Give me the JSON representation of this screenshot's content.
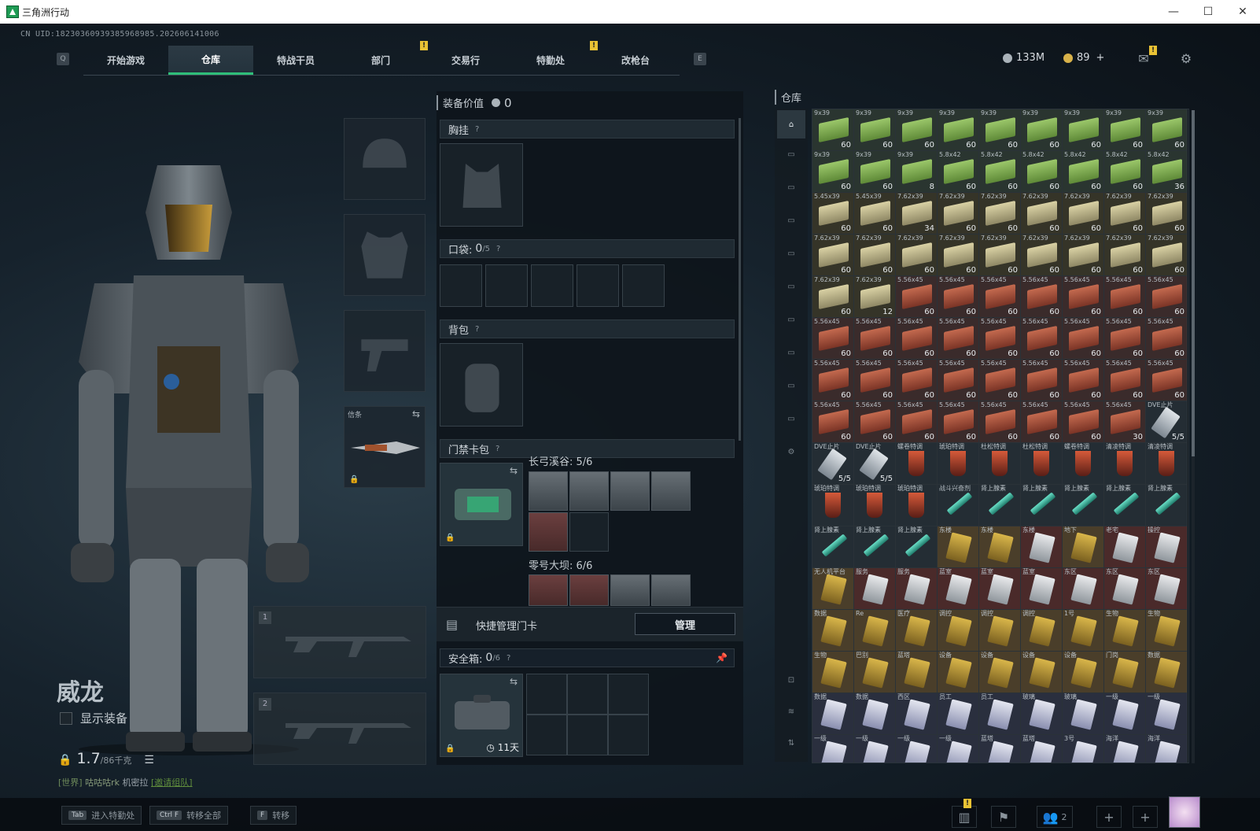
{
  "window": {
    "title": "三角洲行动",
    "minimize": "—",
    "maximize": "☐",
    "close": "✕"
  },
  "uid": "CN UID:18230360939385968985.202606141006",
  "nav": {
    "key_left": "Q",
    "key_right": "E",
    "tabs": [
      {
        "label": "开始游戏"
      },
      {
        "label": "仓库"
      },
      {
        "label": "特战干员"
      },
      {
        "label": "部门",
        "badge": "!"
      },
      {
        "label": "交易行"
      },
      {
        "label": "特勤处",
        "badge": "!"
      },
      {
        "label": "改枪台"
      }
    ]
  },
  "currency": {
    "silver": "133M",
    "gold": "89",
    "plus": "+"
  },
  "mail_badge": "!",
  "operator": {
    "name": "威龙",
    "show_gear": "显示装备",
    "weight": "1.7",
    "weight_unit": "/86千克"
  },
  "chat": {
    "channel": "[世界]",
    "name": "咕咕咕rk",
    "msg": "机密拉",
    "link": "[邀请组队]"
  },
  "gear": {
    "melee_label": "信条",
    "weapon1": "1",
    "weapon2": "2"
  },
  "loadout": {
    "value_label": "装备价值",
    "value": "0",
    "chest": "胸挂",
    "pocket": "口袋:",
    "pocket_count": "0",
    "pocket_cap": "/5",
    "backpack": "背包",
    "keycard_pack": "门禁卡包",
    "keyset1": {
      "name": "长弓溪谷:",
      "count": "5/6"
    },
    "keyset2": {
      "name": "零号大坝:",
      "count": "6/6"
    },
    "quick_manage": "快捷管理门卡",
    "manage_btn": "管理",
    "safe_box": "安全箱:",
    "safe_count": "0",
    "safe_cap": "/6",
    "safe_timer": "11天",
    "help": "?"
  },
  "warehouse": {
    "title": "仓库",
    "items": [
      {
        "l": "9x39",
        "c": "60",
        "t": "green"
      },
      {
        "l": "9x39",
        "c": "60",
        "t": "green"
      },
      {
        "l": "9x39",
        "c": "60",
        "t": "green"
      },
      {
        "l": "9x39",
        "c": "60",
        "t": "green"
      },
      {
        "l": "9x39",
        "c": "60",
        "t": "green"
      },
      {
        "l": "9x39",
        "c": "60",
        "t": "green"
      },
      {
        "l": "9x39",
        "c": "60",
        "t": "green"
      },
      {
        "l": "9x39",
        "c": "60",
        "t": "green"
      },
      {
        "l": "9x39",
        "c": "60",
        "t": "green"
      },
      {
        "l": "9x39",
        "c": "60",
        "t": "green"
      },
      {
        "l": "9x39",
        "c": "60",
        "t": "green"
      },
      {
        "l": "9x39",
        "c": "8",
        "t": "green"
      },
      {
        "l": "5.8x42",
        "c": "60",
        "t": "green"
      },
      {
        "l": "5.8x42",
        "c": "60",
        "t": "green"
      },
      {
        "l": "5.8x42",
        "c": "60",
        "t": "green"
      },
      {
        "l": "5.8x42",
        "c": "60",
        "t": "green"
      },
      {
        "l": "5.8x42",
        "c": "60",
        "t": "green"
      },
      {
        "l": "5.8x42",
        "c": "36",
        "t": "green"
      },
      {
        "l": "5.45x39",
        "c": "60",
        "t": "tan"
      },
      {
        "l": "5.45x39",
        "c": "60",
        "t": "tan"
      },
      {
        "l": "7.62x39",
        "c": "34",
        "t": "tan"
      },
      {
        "l": "7.62x39",
        "c": "60",
        "t": "tan"
      },
      {
        "l": "7.62x39",
        "c": "60",
        "t": "tan"
      },
      {
        "l": "7.62x39",
        "c": "60",
        "t": "tan"
      },
      {
        "l": "7.62x39",
        "c": "60",
        "t": "tan"
      },
      {
        "l": "7.62x39",
        "c": "60",
        "t": "tan"
      },
      {
        "l": "7.62x39",
        "c": "60",
        "t": "tan"
      },
      {
        "l": "7.62x39",
        "c": "60",
        "t": "tan"
      },
      {
        "l": "7.62x39",
        "c": "60",
        "t": "tan"
      },
      {
        "l": "7.62x39",
        "c": "60",
        "t": "tan"
      },
      {
        "l": "7.62x39",
        "c": "60",
        "t": "tan"
      },
      {
        "l": "7.62x39",
        "c": "60",
        "t": "tan"
      },
      {
        "l": "7.62x39",
        "c": "60",
        "t": "tan"
      },
      {
        "l": "7.62x39",
        "c": "60",
        "t": "tan"
      },
      {
        "l": "7.62x39",
        "c": "60",
        "t": "tan"
      },
      {
        "l": "7.62x39",
        "c": "60",
        "t": "tan"
      },
      {
        "l": "7.62x39",
        "c": "60",
        "t": "tan"
      },
      {
        "l": "7.62x39",
        "c": "12",
        "t": "tan"
      },
      {
        "l": "5.56x45",
        "c": "60",
        "t": "red"
      },
      {
        "l": "5.56x45",
        "c": "60",
        "t": "red"
      },
      {
        "l": "5.56x45",
        "c": "60",
        "t": "red"
      },
      {
        "l": "5.56x45",
        "c": "60",
        "t": "red"
      },
      {
        "l": "5.56x45",
        "c": "60",
        "t": "red"
      },
      {
        "l": "5.56x45",
        "c": "60",
        "t": "red"
      },
      {
        "l": "5.56x45",
        "c": "60",
        "t": "red"
      },
      {
        "l": "5.56x45",
        "c": "60",
        "t": "red"
      },
      {
        "l": "5.56x45",
        "c": "60",
        "t": "red"
      },
      {
        "l": "5.56x45",
        "c": "60",
        "t": "red"
      },
      {
        "l": "5.56x45",
        "c": "60",
        "t": "red"
      },
      {
        "l": "5.56x45",
        "c": "60",
        "t": "red"
      },
      {
        "l": "5.56x45",
        "c": "60",
        "t": "red"
      },
      {
        "l": "5.56x45",
        "c": "60",
        "t": "red"
      },
      {
        "l": "5.56x45",
        "c": "60",
        "t": "red"
      },
      {
        "l": "5.56x45",
        "c": "60",
        "t": "red"
      },
      {
        "l": "5.56x45",
        "c": "60",
        "t": "red"
      },
      {
        "l": "5.56x45",
        "c": "60",
        "t": "red"
      },
      {
        "l": "5.56x45",
        "c": "60",
        "t": "red"
      },
      {
        "l": "5.56x45",
        "c": "60",
        "t": "red"
      },
      {
        "l": "5.56x45",
        "c": "60",
        "t": "red"
      },
      {
        "l": "5.56x45",
        "c": "60",
        "t": "red"
      },
      {
        "l": "5.56x45",
        "c": "60",
        "t": "red"
      },
      {
        "l": "5.56x45",
        "c": "60",
        "t": "red"
      },
      {
        "l": "5.56x45",
        "c": "60",
        "t": "red"
      },
      {
        "l": "5.56x45",
        "c": "60",
        "t": "red"
      },
      {
        "l": "5.56x45",
        "c": "60",
        "t": "red"
      },
      {
        "l": "5.56x45",
        "c": "60",
        "t": "red"
      },
      {
        "l": "5.56x45",
        "c": "60",
        "t": "red"
      },
      {
        "l": "5.56x45",
        "c": "60",
        "t": "red"
      },
      {
        "l": "5.56x45",
        "c": "60",
        "t": "red"
      },
      {
        "l": "5.56x45",
        "c": "60",
        "t": "red"
      },
      {
        "l": "5.56x45",
        "c": "30",
        "t": "red"
      },
      {
        "l": "DVE止片",
        "c": "5/5",
        "t": "dve"
      },
      {
        "l": "DVE止片",
        "c": "5/5",
        "t": "dve"
      },
      {
        "l": "DVE止片",
        "c": "5/5",
        "t": "dve"
      },
      {
        "l": "螺卷特调",
        "c": "",
        "t": "glass"
      },
      {
        "l": "琥珀特调",
        "c": "",
        "t": "glass"
      },
      {
        "l": "杜松特调",
        "c": "",
        "t": "glass"
      },
      {
        "l": "杜松特调",
        "c": "",
        "t": "glass"
      },
      {
        "l": "螺卷特调",
        "c": "",
        "t": "glass"
      },
      {
        "l": "清凌特调",
        "c": "",
        "t": "glass"
      },
      {
        "l": "清凌特调",
        "c": "",
        "t": "glass"
      },
      {
        "l": "琥珀特调",
        "c": "",
        "t": "glass"
      },
      {
        "l": "琥珀特调",
        "c": "",
        "t": "glass"
      },
      {
        "l": "琥珀特调",
        "c": "",
        "t": "glass"
      },
      {
        "l": "战斗兴奋剂",
        "c": "",
        "t": "syr"
      },
      {
        "l": "肾上腺素",
        "c": "",
        "t": "syr"
      },
      {
        "l": "肾上腺素",
        "c": "",
        "t": "syr"
      },
      {
        "l": "肾上腺素",
        "c": "",
        "t": "syr"
      },
      {
        "l": "肾上腺素",
        "c": "",
        "t": "syr"
      },
      {
        "l": "肾上腺素",
        "c": "",
        "t": "syr"
      },
      {
        "l": "肾上腺素",
        "c": "",
        "t": "syr"
      },
      {
        "l": "肾上腺素",
        "c": "",
        "t": "syr"
      },
      {
        "l": "肾上腺素",
        "c": "",
        "t": "syr"
      },
      {
        "l": "东楼",
        "c": "",
        "t": "keyg"
      },
      {
        "l": "东楼",
        "c": "",
        "t": "keyg"
      },
      {
        "l": "东楼",
        "c": "",
        "t": "keyr"
      },
      {
        "l": "地下",
        "c": "",
        "t": "keyg"
      },
      {
        "l": "老宅",
        "c": "",
        "t": "keyr"
      },
      {
        "l": "操控",
        "c": "",
        "t": "keyr"
      },
      {
        "l": "无人机平台",
        "c": "",
        "t": "keyg"
      },
      {
        "l": "服务",
        "c": "",
        "t": "keyr"
      },
      {
        "l": "服务",
        "c": "",
        "t": "keyr"
      },
      {
        "l": "蓝室",
        "c": "",
        "t": "keyr"
      },
      {
        "l": "蓝室",
        "c": "",
        "t": "keyr"
      },
      {
        "l": "蓝室",
        "c": "",
        "t": "keyr"
      },
      {
        "l": "东区",
        "c": "",
        "t": "keyr"
      },
      {
        "l": "东区",
        "c": "",
        "t": "keyr"
      },
      {
        "l": "东区",
        "c": "",
        "t": "keyr"
      },
      {
        "l": "数据",
        "c": "",
        "t": "keyg"
      },
      {
        "l": "Re",
        "c": "",
        "t": "keyg"
      },
      {
        "l": "医疗",
        "c": "",
        "t": "keyg"
      },
      {
        "l": "调控",
        "c": "",
        "t": "keyg"
      },
      {
        "l": "调控",
        "c": "",
        "t": "keyg"
      },
      {
        "l": "调控",
        "c": "",
        "t": "keyg"
      },
      {
        "l": "1号",
        "c": "",
        "t": "keyg"
      },
      {
        "l": "生物",
        "c": "",
        "t": "keyg"
      },
      {
        "l": "生物",
        "c": "",
        "t": "keyg"
      },
      {
        "l": "生物",
        "c": "",
        "t": "keyg"
      },
      {
        "l": "巴别",
        "c": "",
        "t": "keyg"
      },
      {
        "l": "蓝塔",
        "c": "",
        "t": "keyg"
      },
      {
        "l": "设备",
        "c": "",
        "t": "keyg"
      },
      {
        "l": "设备",
        "c": "",
        "t": "keyg"
      },
      {
        "l": "设备",
        "c": "",
        "t": "keyg"
      },
      {
        "l": "设备",
        "c": "",
        "t": "keyg"
      },
      {
        "l": "门岗",
        "c": "",
        "t": "keyg"
      },
      {
        "l": "数据",
        "c": "",
        "t": "keyg"
      },
      {
        "l": "数据",
        "c": "",
        "t": "keyb"
      },
      {
        "l": "数据",
        "c": "",
        "t": "keyb"
      },
      {
        "l": "西区",
        "c": "",
        "t": "keyb"
      },
      {
        "l": "员工",
        "c": "",
        "t": "keyb"
      },
      {
        "l": "员工",
        "c": "",
        "t": "keyb"
      },
      {
        "l": "玻璃",
        "c": "",
        "t": "keyb"
      },
      {
        "l": "玻璃",
        "c": "",
        "t": "keyb"
      },
      {
        "l": "一级",
        "c": "",
        "t": "keyb"
      },
      {
        "l": "一级",
        "c": "",
        "t": "keyb"
      },
      {
        "l": "一级",
        "c": "",
        "t": "keyb"
      },
      {
        "l": "一级",
        "c": "",
        "t": "keyb"
      },
      {
        "l": "一级",
        "c": "",
        "t": "keyb"
      },
      {
        "l": "一级",
        "c": "",
        "t": "keyb"
      },
      {
        "l": "蓝塔",
        "c": "",
        "t": "keyb"
      },
      {
        "l": "蓝塔",
        "c": "",
        "t": "keyb"
      },
      {
        "l": "3号",
        "c": "",
        "t": "keyb"
      },
      {
        "l": "海洋",
        "c": "",
        "t": "keyb"
      },
      {
        "l": "海洋",
        "c": "",
        "t": "keyb"
      }
    ]
  },
  "bottom": {
    "hint1_key": "Tab",
    "hint1": "进入特勤处",
    "hint2_key": "Ctrl F",
    "hint2": "转移全部",
    "hint3_key": "F",
    "hint3": "转移",
    "friends": "2",
    "badge": "!"
  },
  "colors": {
    "accent": "#2fbf7a",
    "badge": "#e9c234"
  }
}
